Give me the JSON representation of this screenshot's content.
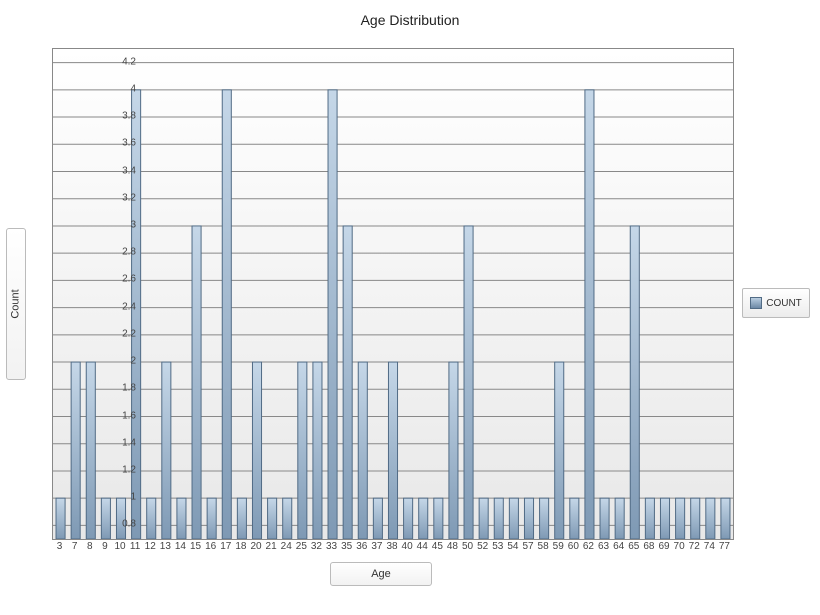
{
  "chart_data": {
    "type": "bar",
    "title": "Age Distribution",
    "xlabel": "Age",
    "ylabel": "Count",
    "ylim": [
      0.7,
      4.3
    ],
    "yticks": [
      0.8,
      1,
      1.2,
      1.4,
      1.6,
      1.8,
      2,
      2.2,
      2.4,
      2.6,
      2.8,
      3,
      3.2,
      3.4,
      3.6,
      3.8,
      4,
      4.2
    ],
    "categories": [
      "3",
      "7",
      "8",
      "9",
      "10",
      "11",
      "12",
      "13",
      "14",
      "15",
      "16",
      "17",
      "18",
      "20",
      "21",
      "24",
      "25",
      "32",
      "33",
      "35",
      "36",
      "37",
      "38",
      "40",
      "44",
      "45",
      "48",
      "50",
      "52",
      "53",
      "54",
      "57",
      "58",
      "59",
      "60",
      "62",
      "63",
      "64",
      "65",
      "68",
      "69",
      "70",
      "72",
      "74",
      "77"
    ],
    "series": [
      {
        "name": "COUNT",
        "values": [
          1,
          2,
          2,
          1,
          1,
          4,
          1,
          2,
          1,
          3,
          1,
          4,
          1,
          2,
          1,
          1,
          2,
          2,
          4,
          3,
          2,
          1,
          2,
          1,
          1,
          1,
          2,
          3,
          1,
          1,
          1,
          1,
          1,
          2,
          1,
          4,
          1,
          1,
          3,
          1,
          1,
          1,
          1,
          1,
          1
        ]
      }
    ],
    "legend": "COUNT"
  }
}
